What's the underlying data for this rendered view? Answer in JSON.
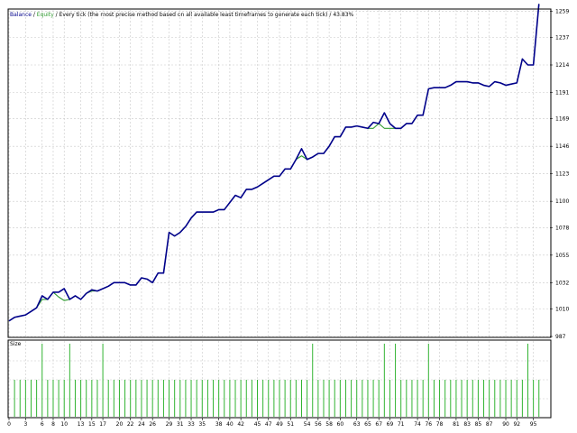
{
  "header": {
    "balance": "Balance",
    "sep1": " / ",
    "equity": "Equity",
    "rest": " / Every tick (the most precise method based on all available least timeframes to generate each tick) / 43.83%"
  },
  "size_label": "Size",
  "colors": {
    "balance": "#00008b",
    "equity": "#2e9b2e",
    "size": "#32b432",
    "grid": "#c8c8c8",
    "frame": "#000000"
  },
  "chart_data": {
    "type": "line",
    "ylim": [
      987,
      1260
    ],
    "yticks": [
      "987",
      "1010",
      "1032",
      "1055",
      "1078",
      "1100",
      "1123",
      "1146",
      "1169",
      "1191",
      "1214",
      "1237",
      "1259"
    ],
    "xlim": [
      0,
      98
    ],
    "xticks": [
      "0",
      "3",
      "6",
      "8",
      "10",
      "13",
      "15",
      "17",
      "20",
      "22",
      "24",
      "26",
      "29",
      "31",
      "33",
      "35",
      "38",
      "40",
      "42",
      "45",
      "47",
      "49",
      "51",
      "54",
      "56",
      "58",
      "60",
      "63",
      "65",
      "67",
      "69",
      "71",
      "74",
      "76",
      "78",
      "81",
      "83",
      "85",
      "87",
      "90",
      "92",
      "95"
    ],
    "series": [
      {
        "name": "Balance",
        "x": [
          0,
          1,
          2,
          3,
          4,
          5,
          6,
          7,
          8,
          9,
          10,
          11,
          12,
          13,
          14,
          15,
          16,
          17,
          18,
          19,
          20,
          21,
          22,
          23,
          24,
          25,
          26,
          27,
          28,
          29,
          30,
          31,
          32,
          33,
          34,
          35,
          36,
          37,
          38,
          39,
          40,
          41,
          42,
          43,
          44,
          45,
          46,
          47,
          48,
          49,
          50,
          51,
          52,
          53,
          54,
          55,
          56,
          57,
          58,
          59,
          60,
          61,
          62,
          63,
          64,
          65,
          66,
          67,
          68,
          69,
          70,
          71,
          72,
          73,
          74,
          75,
          76,
          77,
          78,
          79,
          80,
          81,
          82,
          83,
          84,
          85,
          86,
          87,
          88,
          89,
          90,
          91,
          92,
          93,
          94,
          95,
          96
        ],
        "values": [
          1000,
          1003,
          1004,
          1005,
          1008,
          1011,
          1021,
          1018,
          1024,
          1024,
          1027,
          1018,
          1021,
          1018,
          1023,
          1026,
          1025,
          1027,
          1029,
          1032,
          1032,
          1032,
          1030,
          1030,
          1036,
          1035,
          1032,
          1040,
          1040,
          1074,
          1071,
          1074,
          1079,
          1086,
          1091,
          1091,
          1091,
          1091,
          1093,
          1093,
          1099,
          1105,
          1103,
          1110,
          1110,
          1112,
          1115,
          1118,
          1121,
          1121,
          1127,
          1127,
          1135,
          1144,
          1135,
          1137,
          1140,
          1140,
          1146,
          1154,
          1154,
          1162,
          1162,
          1163,
          1162,
          1161,
          1166,
          1165,
          1174,
          1165,
          1161,
          1161,
          1165,
          1165,
          1172,
          1172,
          1194,
          1195,
          1195,
          1195,
          1197,
          1200,
          1200,
          1200,
          1199,
          1199,
          1197,
          1196,
          1200,
          1199,
          1197,
          1198,
          1199,
          1219,
          1214,
          1214,
          1265
        ]
      },
      {
        "name": "Equity",
        "x": [
          0,
          1,
          2,
          3,
          4,
          5,
          6,
          7,
          8,
          9,
          10,
          11,
          12,
          13,
          14,
          15,
          16,
          17,
          18,
          19,
          20,
          21,
          22,
          23,
          24,
          25,
          26,
          27,
          28,
          29,
          30,
          31,
          32,
          33,
          34,
          35,
          36,
          37,
          38,
          39,
          40,
          41,
          42,
          43,
          44,
          45,
          46,
          47,
          48,
          49,
          50,
          51,
          52,
          53,
          54,
          55,
          56,
          57,
          58,
          59,
          60,
          61,
          62,
          63,
          64,
          65,
          66,
          67,
          68,
          69,
          70,
          71,
          72,
          73,
          74,
          75,
          76,
          77,
          78,
          79,
          80,
          81,
          82,
          83,
          84,
          85,
          86,
          87,
          88,
          89,
          90,
          91,
          92,
          93,
          94,
          95,
          96
        ],
        "values": [
          1000,
          1003,
          1004,
          1005,
          1008,
          1011,
          1018,
          1018,
          1024,
          1020,
          1017,
          1018,
          1021,
          1018,
          1023,
          1025,
          1025,
          1027,
          1029,
          1032,
          1032,
          1032,
          1030,
          1030,
          1036,
          1035,
          1032,
          1040,
          1040,
          1074,
          1071,
          1074,
          1079,
          1086,
          1091,
          1091,
          1091,
          1091,
          1093,
          1093,
          1099,
          1105,
          1103,
          1110,
          1110,
          1112,
          1115,
          1118,
          1121,
          1121,
          1127,
          1127,
          1135,
          1138,
          1135,
          1137,
          1140,
          1140,
          1146,
          1154,
          1154,
          1162,
          1162,
          1163,
          1162,
          1161,
          1161,
          1165,
          1161,
          1161,
          1161,
          1161,
          1165,
          1165,
          1172,
          1172,
          1194,
          1195,
          1195,
          1195,
          1197,
          1200,
          1200,
          1200,
          1199,
          1199,
          1197,
          1196,
          1200,
          1199,
          1197,
          1198,
          1199,
          1219,
          1214,
          1214,
          1265
        ]
      }
    ],
    "size_series": {
      "name": "Size",
      "tall_at": [
        6,
        11,
        17,
        55,
        68,
        70,
        76,
        94
      ],
      "short_every": 1
    }
  }
}
